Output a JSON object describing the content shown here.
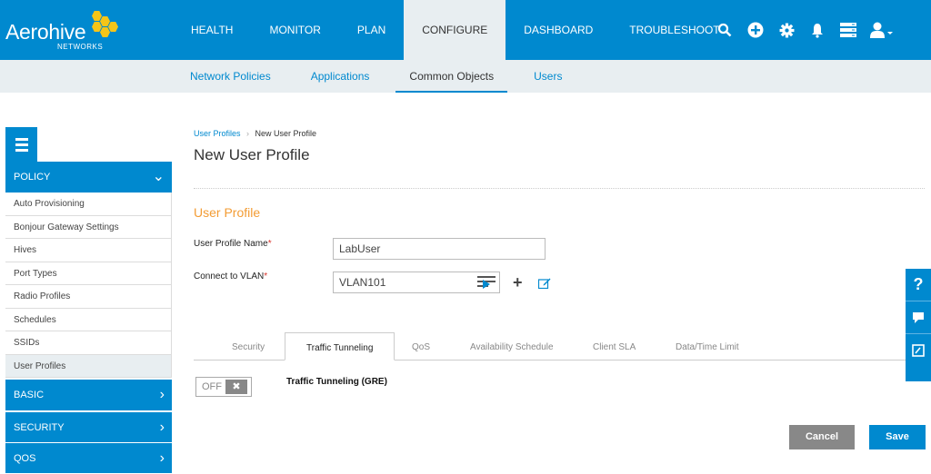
{
  "brand": {
    "name": "Aerohive",
    "sub": "NETWORKS"
  },
  "nav": [
    "HEALTH",
    "MONITOR",
    "PLAN",
    "CONFIGURE",
    "DASHBOARD",
    "TROUBLESHOOT"
  ],
  "active_nav": "CONFIGURE",
  "icons": [
    "search-icon",
    "add-icon",
    "gear-icon",
    "bell-icon",
    "server-icon",
    "user-icon"
  ],
  "subnav": [
    "Network Policies",
    "Applications",
    "Common Objects",
    "Users"
  ],
  "sidebar": {
    "section_policy": "POLICY",
    "items": [
      "Auto Provisioning",
      "Bonjour Gateway Settings",
      "Hives",
      "Port Types",
      "Radio Profiles",
      "Schedules",
      "SSIDs",
      "User Profiles"
    ],
    "section_basic": "BASIC",
    "section_security": "SECURITY",
    "section_qos": "QOS"
  },
  "breadcrumb": {
    "link": "User Profiles",
    "sep": "›",
    "current": "New User Profile"
  },
  "page_title": "New User Profile",
  "section_title": "User Profile",
  "form": {
    "name_label": "User Profile Name",
    "name_value": "LabUser",
    "vlan_label": "Connect to VLAN",
    "vlan_value": "VLAN101",
    "required_mark": "*"
  },
  "tabs": [
    "Security",
    "Traffic Tunneling",
    "QoS",
    "Availability Schedule",
    "Client SLA",
    "Data/Time Limit"
  ],
  "active_tab": "Traffic Tunneling",
  "toggle": {
    "state": "OFF",
    "icon": "✖",
    "label": "Traffic Tunneling (GRE)"
  },
  "buttons": {
    "cancel": "Cancel",
    "save": "Save"
  },
  "helpbar": {
    "help": "?"
  },
  "colors": {
    "primary": "#0089cf",
    "accent": "#f39c34",
    "subbar": "#e8eef1"
  }
}
